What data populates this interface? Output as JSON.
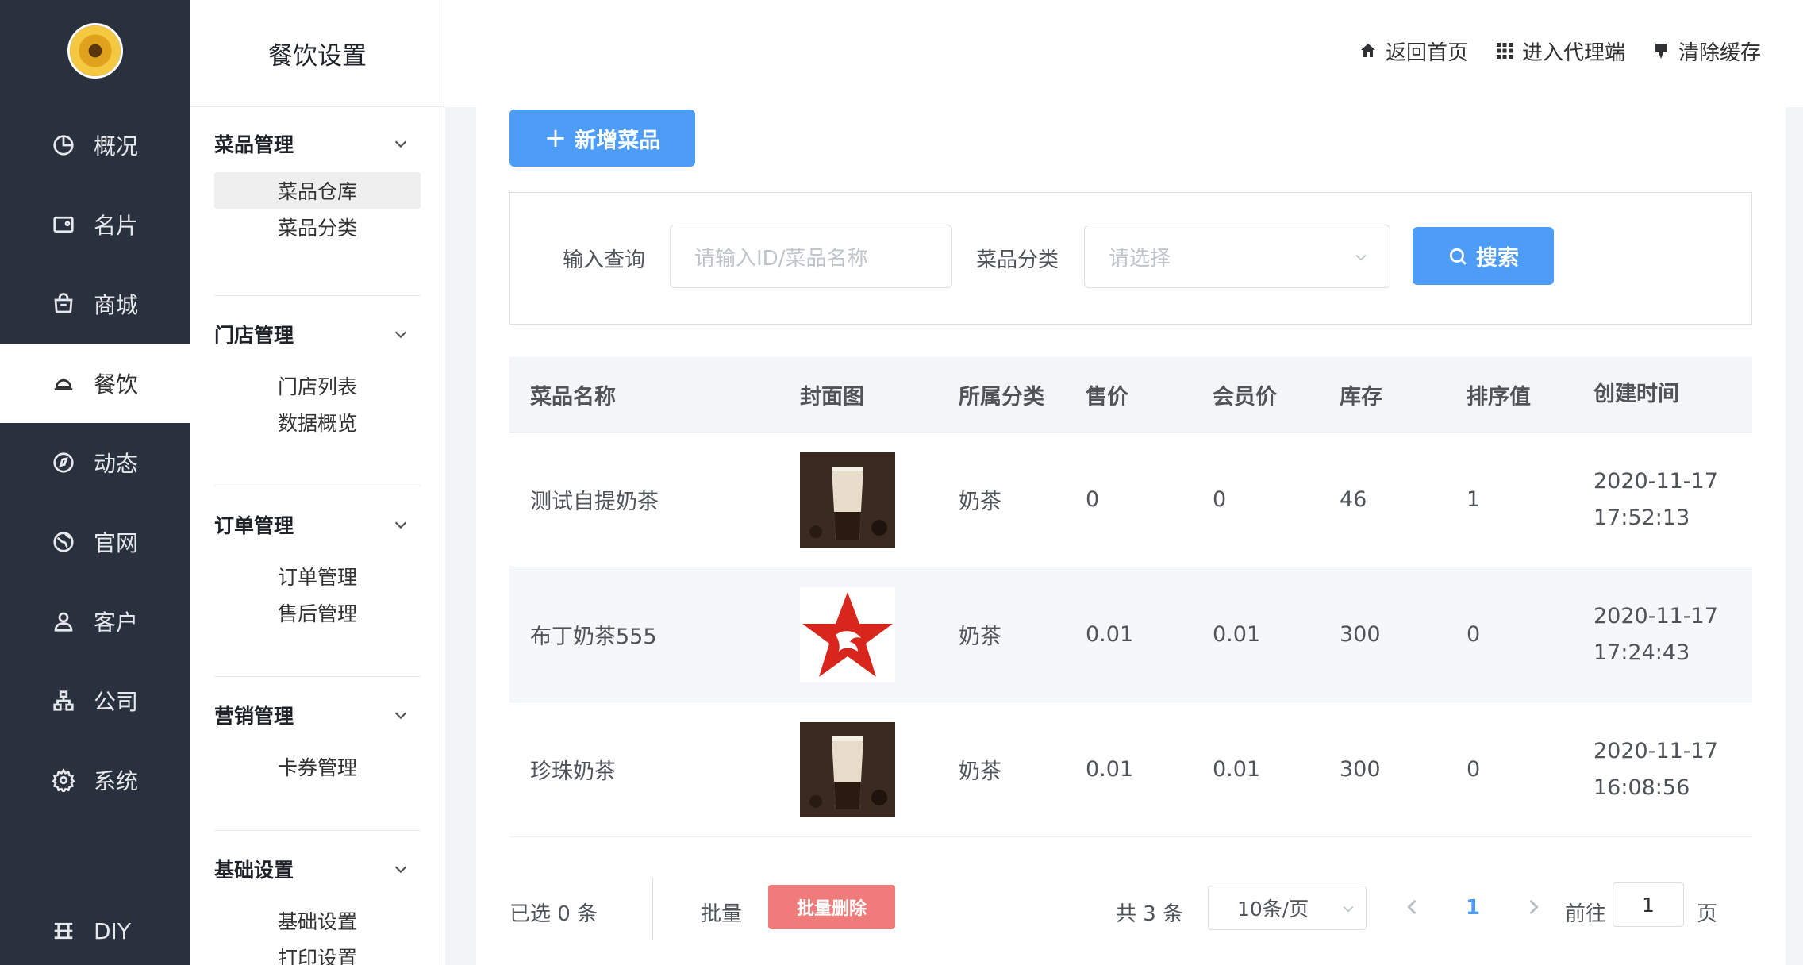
{
  "nav": {
    "items": [
      {
        "label": "概况",
        "icon": "pie-chart-icon"
      },
      {
        "label": "名片",
        "icon": "card-icon"
      },
      {
        "label": "商城",
        "icon": "shopping-bag-icon"
      },
      {
        "label": "餐饮",
        "icon": "cloche-icon"
      },
      {
        "label": "动态",
        "icon": "compass-icon"
      },
      {
        "label": "官网",
        "icon": "globe-icon"
      },
      {
        "label": "客户",
        "icon": "user-icon"
      },
      {
        "label": "公司",
        "icon": "org-icon"
      },
      {
        "label": "系统",
        "icon": "gear-icon"
      }
    ],
    "diy": "DIY",
    "active": "餐饮"
  },
  "sub": {
    "title": "餐饮设置",
    "groups": [
      {
        "title": "菜品管理",
        "items": [
          "菜品仓库",
          "菜品分类"
        ]
      },
      {
        "title": "门店管理",
        "items": [
          "门店列表",
          "数据概览"
        ]
      },
      {
        "title": "订单管理",
        "items": [
          "订单管理",
          "售后管理"
        ]
      },
      {
        "title": "营销管理",
        "items": [
          "卡券管理"
        ]
      },
      {
        "title": "基础设置",
        "items": [
          "基础设置",
          "打印设置"
        ]
      }
    ],
    "active_item": "菜品仓库"
  },
  "header": {
    "home": "返回首页",
    "agent": "进入代理端",
    "clear_cache": "清除缓存"
  },
  "toolbar": {
    "add_label": "新增菜品"
  },
  "search": {
    "query_label": "输入查询",
    "query_placeholder": "请输入ID/菜品名称",
    "category_label": "菜品分类",
    "category_placeholder": "请选择",
    "search_label": "搜索"
  },
  "table": {
    "columns": [
      "菜品名称",
      "封面图",
      "所属分类",
      "售价",
      "会员价",
      "库存",
      "排序值",
      "创建时间"
    ],
    "rows": [
      {
        "name": "测试自提奶茶",
        "cover": "milk-tea-photo",
        "category": "奶茶",
        "price": "0",
        "member_price": "0",
        "stock": "46",
        "sort": "1",
        "date": "2020-11-17",
        "time": "17:52:13"
      },
      {
        "name": "布丁奶茶555",
        "cover": "red-star-logo",
        "category": "奶茶",
        "price": "0.01",
        "member_price": "0.01",
        "stock": "300",
        "sort": "0",
        "date": "2020-11-17",
        "time": "17:24:43"
      },
      {
        "name": "珍珠奶茶",
        "cover": "milk-tea-photo",
        "category": "奶茶",
        "price": "0.01",
        "member_price": "0.01",
        "stock": "300",
        "sort": "0",
        "date": "2020-11-17",
        "time": "16:08:56"
      }
    ]
  },
  "footer": {
    "selected_text": "已选 0 条",
    "batch_label": "批量",
    "batch_delete": "批量删除",
    "total_text": "共 3 条",
    "page_size": "10条/页",
    "current_page": "1",
    "goto_label": "前往",
    "goto_value": "1",
    "page_unit": "页"
  },
  "colors": {
    "nav_bg": "#29303e",
    "primary": "#4d9cf5",
    "danger": "#f07b7b"
  }
}
